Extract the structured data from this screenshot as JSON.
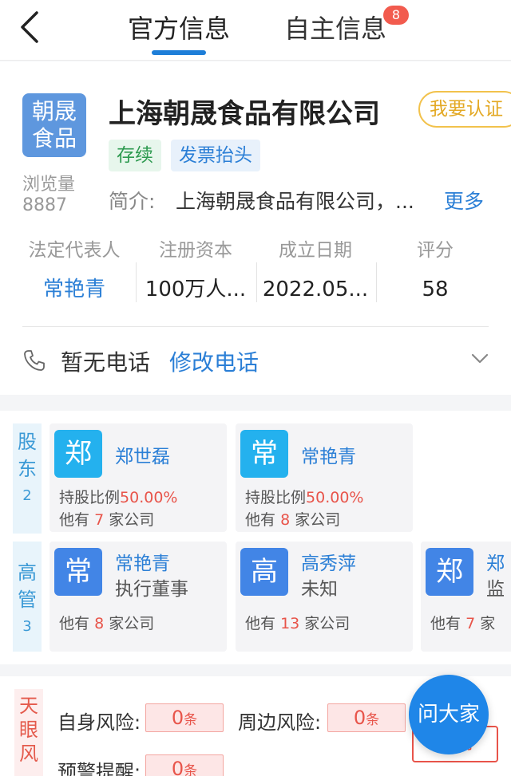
{
  "nav": {
    "tabs": [
      {
        "label": "官方信息"
      },
      {
        "label": "自主信息",
        "badge": "8"
      }
    ]
  },
  "company": {
    "logo_line1": "朝晟",
    "logo_line2": "食品",
    "views_label": "浏览量",
    "views": "8887",
    "name": "上海朝晟食品有限公司",
    "certify_label": "我要认证",
    "tags": [
      "存续",
      "发票抬头"
    ],
    "intro_label": "简介:",
    "intro_text": "上海朝晟食品有限公司，...",
    "more_label": "更多",
    "stats": [
      {
        "label": "法定代表人",
        "value": "常艳青"
      },
      {
        "label": "注册资本",
        "value": "100万人..."
      },
      {
        "label": "成立日期",
        "value": "2022.05..."
      },
      {
        "label": "评分",
        "value": "58"
      }
    ],
    "phone_text": "暂无电话",
    "phone_edit": "修改电话"
  },
  "shareholders": {
    "label_line1": "股",
    "label_line2": "东",
    "count": "2",
    "items": [
      {
        "avatar": "郑",
        "name": "郑世磊",
        "ratio_label": "持股比例",
        "ratio": "50.00%",
        "other_prefix": "他有",
        "other_count": "7",
        "other_suffix": "家公司"
      },
      {
        "avatar": "常",
        "name": "常艳青",
        "ratio_label": "持股比例",
        "ratio": "50.00%",
        "other_prefix": "他有",
        "other_count": "8",
        "other_suffix": "家公司"
      }
    ]
  },
  "executives": {
    "label_line1": "高",
    "label_line2": "管",
    "count": "3",
    "items": [
      {
        "avatar": "常",
        "name": "常艳青",
        "role": "执行董事",
        "other_prefix": "他有",
        "other_count": "8",
        "other_suffix": "家公司"
      },
      {
        "avatar": "高",
        "name": "高秀萍",
        "role": "未知",
        "other_prefix": "他有",
        "other_count": "13",
        "other_suffix": "家公司"
      },
      {
        "avatar": "郑",
        "name": "郑",
        "role": "监",
        "other_prefix": "他有",
        "other_count": "7",
        "other_suffix": "家"
      }
    ]
  },
  "risk": {
    "side_line1": "天",
    "side_line2": "眼",
    "side_line3": "风",
    "self_label": "自身风险:",
    "self_count": "0",
    "around_label": "周边风险:",
    "around_count": "0",
    "warn_label": "预警提醒:",
    "warn_count": "0",
    "unit": "条",
    "case_label": "案例"
  },
  "fab_label": "问大家",
  "colors": {
    "accent": "#1e7ed8",
    "risk": "#e8544a",
    "certify": "#e3a823"
  }
}
